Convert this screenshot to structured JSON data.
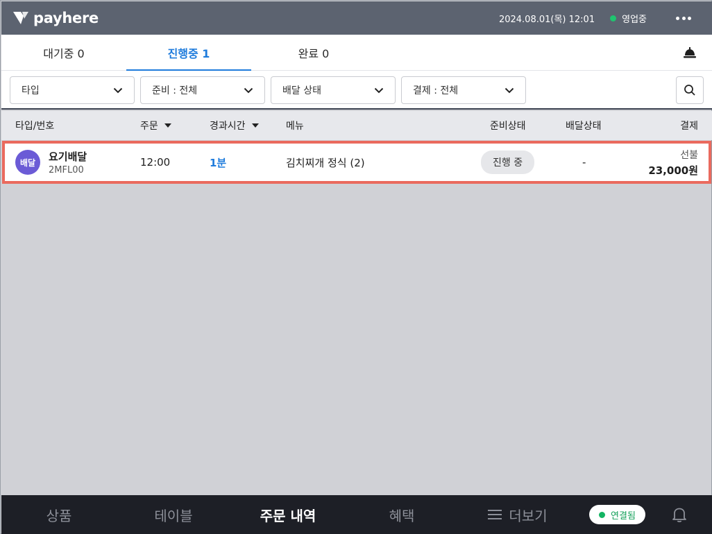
{
  "app": {
    "logo_text": "payhere"
  },
  "topbar": {
    "datetime": "2024.08.01(목) 12:01",
    "status": "영업중",
    "status_color": "#1fc46f"
  },
  "tabs": [
    {
      "label": "대기중 0",
      "active": false
    },
    {
      "label": "진행중 1",
      "active": true
    },
    {
      "label": "완료 0",
      "active": false
    }
  ],
  "filters": [
    {
      "label": "타입"
    },
    {
      "label": "준비 : 전체"
    },
    {
      "label": "배달 상태"
    },
    {
      "label": "결제 : 전체"
    }
  ],
  "table": {
    "headers": {
      "type_no": "타입/번호",
      "order": "주문",
      "elapsed": "경과시간",
      "menu": "메뉴",
      "prep_status": "준비상태",
      "delivery_status": "배달상태",
      "payment": "결제"
    },
    "rows": [
      {
        "type_badge": "배달",
        "type_name": "요기배달",
        "order_no": "2MFL00",
        "order_time": "12:00",
        "elapsed": "1분",
        "menu": "김치찌개 정식 (2)",
        "prep_status": "진행 중",
        "delivery_status": "-",
        "payment_method": "선불",
        "payment_amount": "23,000원"
      }
    ]
  },
  "bottomnav": {
    "items": [
      {
        "label": "상품",
        "active": false
      },
      {
        "label": "테이블",
        "active": false
      },
      {
        "label": "주문 내역",
        "active": true
      },
      {
        "label": "혜택",
        "active": false
      },
      {
        "label": "더보기",
        "active": false
      }
    ],
    "connection": "연결됨"
  },
  "colors": {
    "accent": "#1e7bdc",
    "highlight_border": "#ea6a5e",
    "badge_purple": "#6b5bd6",
    "topbar": "#5c6370",
    "nav_bg": "#1d1f26"
  }
}
